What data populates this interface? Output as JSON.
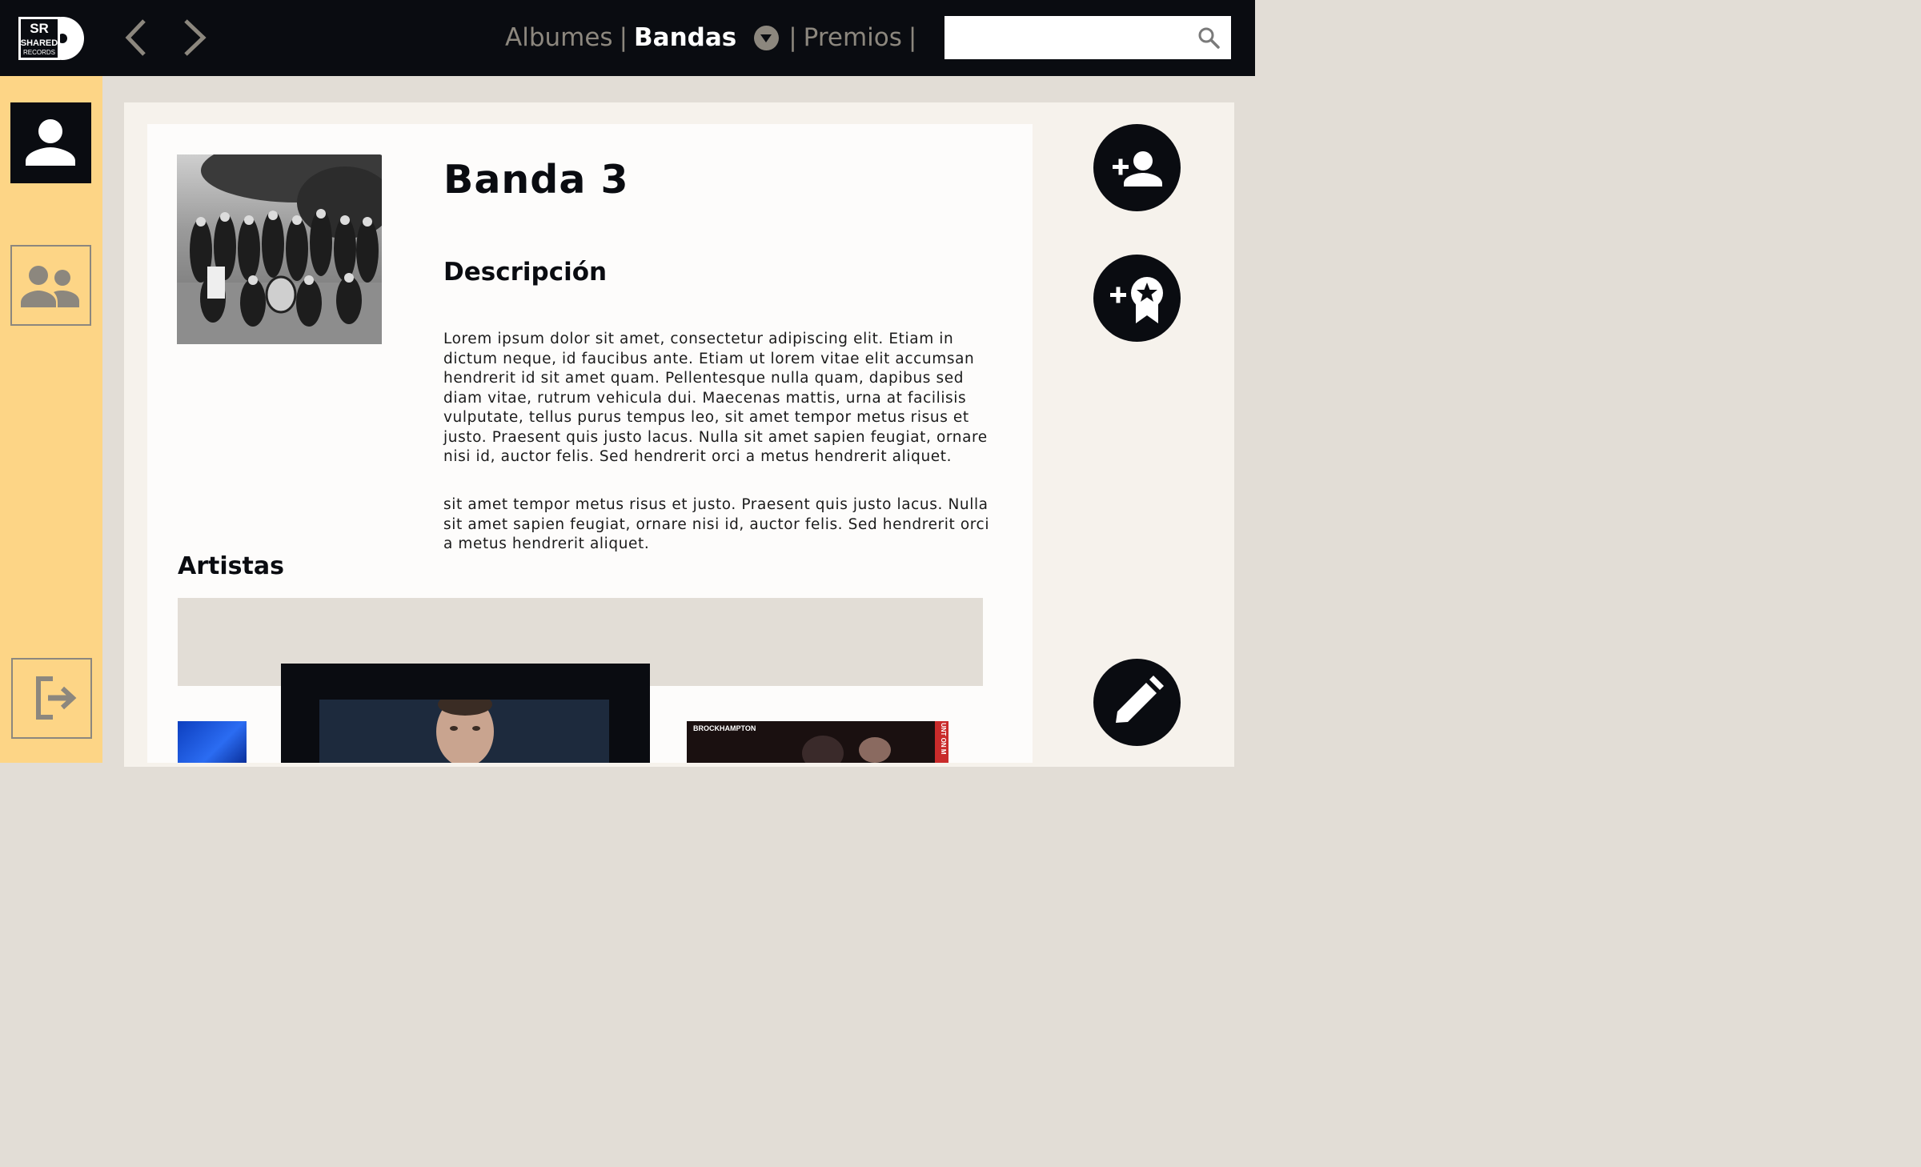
{
  "header": {
    "logo_text": "SR SHARED RECORDS",
    "nav": {
      "albumes": "Albumes",
      "sep1": "|",
      "bandas": "Bandas",
      "sep2": "|",
      "premios": "Premios",
      "sep3": "|"
    },
    "search": {
      "value": "",
      "placeholder": ""
    }
  },
  "band": {
    "name": "Banda 3",
    "description_heading": "Descripción",
    "description_p1": "Lorem ipsum dolor sit amet, consectetur adipiscing elit. Etiam in dictum neque, id faucibus ante. Etiam ut lorem vitae elit accumsan hendrerit id sit amet quam. Pellentesque nulla quam, dapibus sed diam vitae, rutrum vehicula dui. Maecenas mattis, urna at facilisis vulputate, tellus purus tempus leo, sit amet tempor metus risus et justo. Praesent quis justo lacus. Nulla sit amet sapien feugiat, ornare nisi id, auctor felis. Sed hendrerit orci a metus hendrerit aliquet.",
    "description_p2": "sit amet tempor metus risus et justo. Praesent quis justo lacus. Nulla sit amet sapien feugiat, ornare nisi id, auctor felis. Sed hendrerit orci a metus hendrerit aliquet.",
    "artists_heading": "Artistas"
  },
  "artists_carousel": {
    "cover_label": "BROCKHAMPTON",
    "cover_side_text": "UNT ON M"
  },
  "colors": {
    "header_bg": "#0a0c11",
    "sidebar_bg": "#fdd586",
    "page_bg": "#e2ddd6",
    "nav_inactive": "#8c877e",
    "nav_active": "#ffffff"
  },
  "icons": {
    "nav_back": "chevron-left-icon",
    "nav_forward": "chevron-right-icon",
    "search": "search-icon",
    "user": "user-icon",
    "group": "group-icon",
    "logout": "logout-icon",
    "add_member": "person-add-icon",
    "add_award": "award-add-icon",
    "edit": "pencil-icon"
  }
}
